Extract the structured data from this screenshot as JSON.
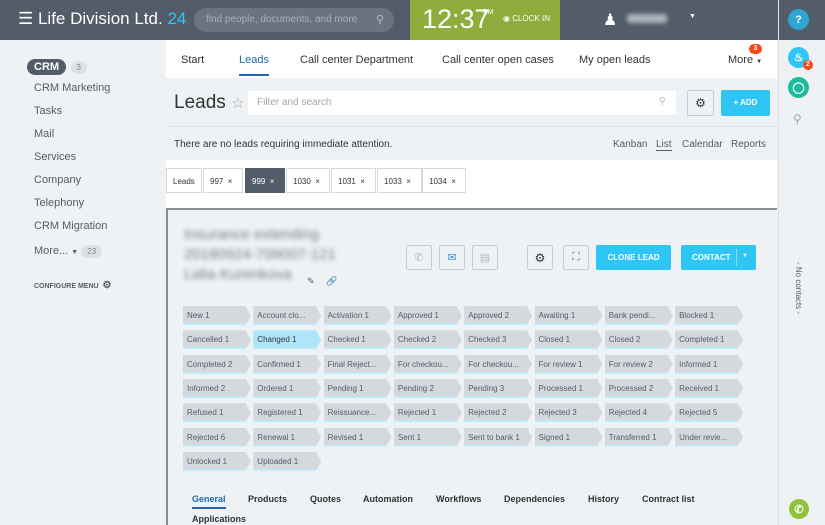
{
  "header": {
    "logo": "Life Division Ltd.",
    "logo_num": "24",
    "search_placeholder": "find people, documents, and more",
    "time": "12:37",
    "ampm": "PM",
    "clock_in": "CLOCK IN",
    "help": "?"
  },
  "sidebar": {
    "crm": "CRM",
    "crm_count": "3",
    "items": [
      "CRM Marketing",
      "Tasks",
      "Mail",
      "Services",
      "Company",
      "Telephony",
      "CRM Migration"
    ],
    "more": "More...",
    "more_count": "23",
    "configure": "CONFIGURE MENU"
  },
  "tabs": {
    "items": [
      "Start",
      "Leads",
      "Call center Department",
      "Call center open cases",
      "My open leads"
    ],
    "more": "More",
    "more_badge": "3"
  },
  "leads": {
    "title": "Leads",
    "filter_placeholder": "Filter and search",
    "add": "ADD",
    "notice": "There are no leads requiring immediate attention.",
    "views": [
      "Kanban",
      "List",
      "Calendar",
      "Reports"
    ]
  },
  "chips": [
    "Leads",
    "997",
    "999",
    "1030",
    "1031",
    "1033",
    "1034"
  ],
  "detail": {
    "title_lines": [
      "Insurance extending",
      "20180924-709007-121",
      "Lidia Kurenkova"
    ],
    "clone": "CLONE LEAD",
    "contact": "CONTACT",
    "stages": [
      "New 1",
      "Account clo...",
      "Activation 1",
      "Approved 1",
      "Approved 2",
      "Awaiting 1",
      "Bank pendi...",
      "Blocked 1",
      "Cancelled 1",
      "Changed 1",
      "Checked 1",
      "Checked 2",
      "Checked 3",
      "Closed 1",
      "Closed 2",
      "Completed 1",
      "Completed 2",
      "Confirmed 1",
      "Final Reject...",
      "For checkou...",
      "For checkou...",
      "For review 1",
      "For review 2",
      "Informed 1",
      "Informed 2",
      "Ordered 1",
      "Pending 1",
      "Pending 2",
      "Pending 3",
      "Processed 1",
      "Processed 2",
      "Received 1",
      "Refused 1",
      "Registered 1",
      "Reissuance...",
      "Rejected 1",
      "Rejected 2",
      "Rejected 3",
      "Rejected 4",
      "Rejected 5",
      "Rejected 6",
      "Renewal 1",
      "Revised 1",
      "Sent 1",
      "Sent to bank 1",
      "Signed 1",
      "Transferred 1",
      "Under revie...",
      "Unlocked 1",
      "Uploaded 1"
    ],
    "active_stage": "Changed 1",
    "tabs": [
      "General",
      "Products",
      "Quotes",
      "Automation",
      "Workflows",
      "Dependencies",
      "History",
      "Contract list",
      "Applications"
    ]
  },
  "right": {
    "notif_badge": "2",
    "no_contacts": "- No contacts -"
  }
}
